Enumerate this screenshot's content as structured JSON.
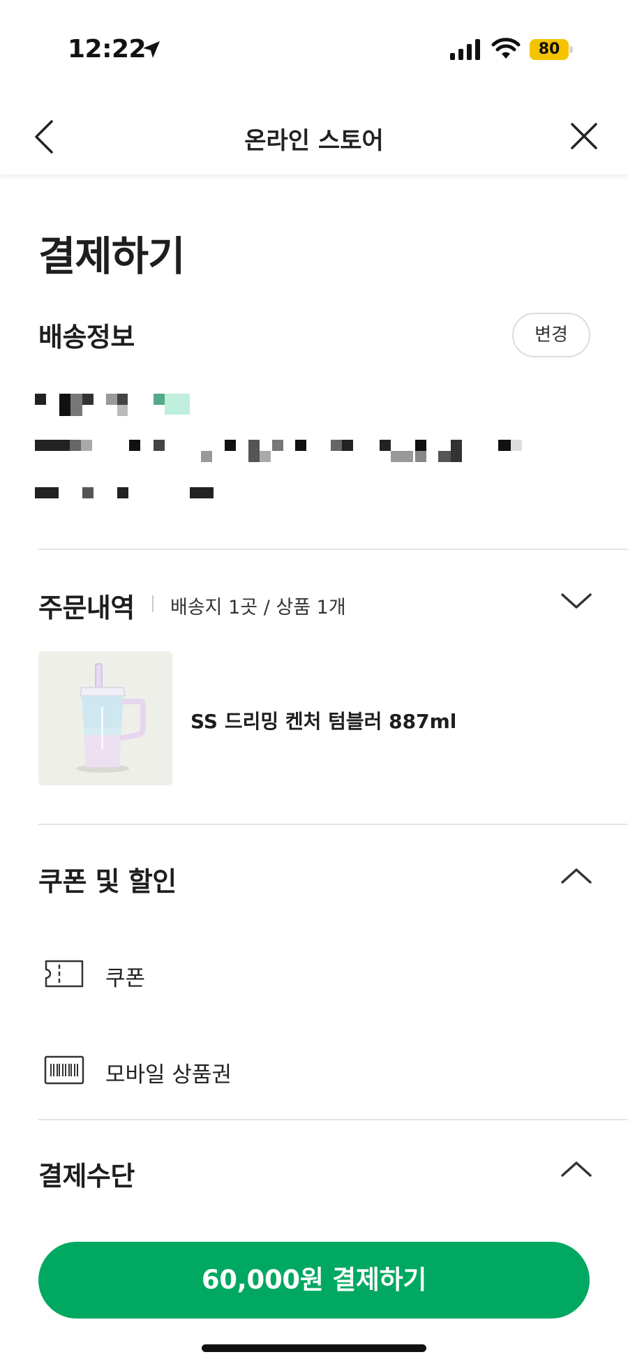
{
  "status_bar": {
    "time": "12:22",
    "battery": "80",
    "battery_color": "#f5c400"
  },
  "nav": {
    "title": "온라인 스토어",
    "back_icon": "chevron-left-icon",
    "close_icon": "close-icon"
  },
  "page": {
    "title": "결제하기"
  },
  "shipping": {
    "heading": "배송정보",
    "change_label": "변경"
  },
  "order": {
    "heading": "주문내역",
    "summary": "배송지 1곳 / 상품 1개",
    "product_name": "SS 드리밍 켄처 텀블러 887ml",
    "expand_icon": "chevron-down-icon"
  },
  "discounts": {
    "heading": "쿠폰 및 할인",
    "collapse_icon": "chevron-up-icon",
    "items": [
      {
        "label": "쿠폰",
        "icon": "ticket-icon"
      },
      {
        "label": "모바일 상품권",
        "icon": "barcode-card-icon"
      }
    ]
  },
  "payment": {
    "heading": "결제수단",
    "collapse_icon": "chevron-up-icon",
    "pay_button_label": "60,000원 결제하기"
  },
  "colors": {
    "brand_green": "#00a862",
    "text": "#222222",
    "divider": "#e4e4e4"
  }
}
